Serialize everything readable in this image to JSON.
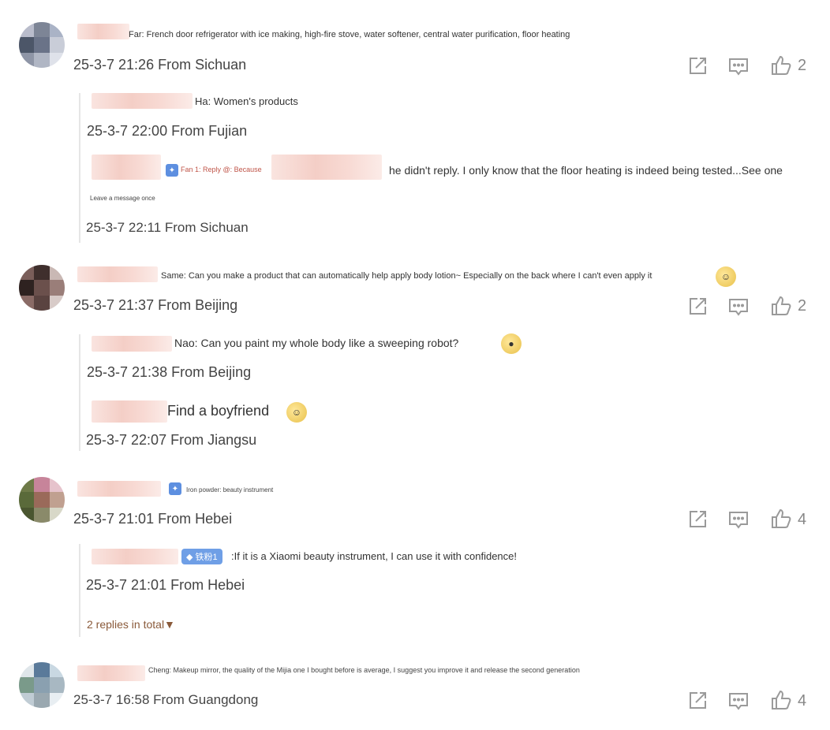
{
  "comments": [
    {
      "text": "Far: French door refrigerator with ice making, high-fire stove, water softener, central water purification, floor heating",
      "meta": "25-3-7 21:26 From Sichuan",
      "likes": "2",
      "replies": [
        {
          "text": "Ha: Women's products",
          "meta": "25-3-7 22:00 From Fujian"
        },
        {
          "badge": "Fan 1: Reply @: Because",
          "text": "he didn't reply. I only know that the floor heating is indeed being tested...See one",
          "sub": "Leave a message once",
          "meta": "25-3-7 22:11 From Sichuan"
        }
      ]
    },
    {
      "text": "Same: Can you make a product that can automatically help apply body lotion~ Especially on the back where I can't even apply it",
      "meta": "25-3-7 21:37 From Beijing",
      "likes": "2",
      "replies": [
        {
          "text": "Nao: Can you paint my whole body like a sweeping robot?",
          "meta": "25-3-7 21:38 From Beijing"
        },
        {
          "text": "Find a boyfriend",
          "meta": "25-3-7 22:07 From Jiangsu"
        }
      ]
    },
    {
      "badge": "Iron powder: beauty instrument",
      "meta": "25-3-7 21:01 From Hebei",
      "likes": "4",
      "replies": [
        {
          "badge": "铁粉1",
          "text": ":If it is a Xiaomi beauty instrument, I can use it with confidence!",
          "meta": "25-3-7 21:01 From Hebei"
        }
      ],
      "more": "2 replies in total▼"
    },
    {
      "text": "Cheng: Makeup mirror, the quality of the Mijia one I bought before is average, I suggest you improve it and release the second generation",
      "meta": "25-3-7 16:58 From Guangdong",
      "likes": "4"
    }
  ],
  "icons": {
    "share": "share-icon",
    "comment": "comment-icon",
    "like": "thumbs-up-icon"
  },
  "colors": {
    "badge": "#6f9fe6",
    "link": "#8a5a3a",
    "meta": "#444444",
    "icon": "#9a9a9a"
  }
}
